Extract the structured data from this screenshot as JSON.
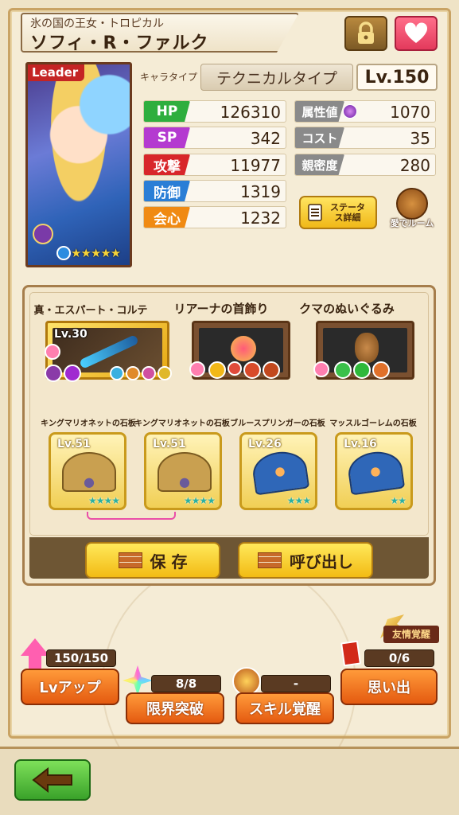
{
  "header": {
    "subtitle": "氷の国の王女・トロピカル",
    "name": "ソフィ・R・ファルク"
  },
  "portrait": {
    "leader_label": "Leader",
    "rarity_stars": "★★★★★"
  },
  "character": {
    "type_label": "キャラタイプ",
    "type_value": "テクニカルタイプ",
    "level": "Lv.150"
  },
  "stats_left": [
    {
      "label": "HP",
      "value": "126310",
      "color": "#2eae3e"
    },
    {
      "label": "SP",
      "value": "342",
      "color": "#b43ad0"
    },
    {
      "label": "攻撃",
      "value": "11977",
      "color": "#d8262a"
    },
    {
      "label": "防御",
      "value": "1319",
      "color": "#2a7ed6"
    },
    {
      "label": "会心",
      "value": "1232",
      "color": "#f08a12"
    }
  ],
  "stats_right": [
    {
      "label": "属性値",
      "value": "1070"
    },
    {
      "label": "コスト",
      "value": "35"
    },
    {
      "label": "親密度",
      "value": "280"
    }
  ],
  "buttons": {
    "status_detail": "ステータス詳細",
    "room": "愛でルーム",
    "save": "保 存",
    "recall": "呼び出し",
    "lv_up": "Lvアップ",
    "limit_break": "限界突破",
    "skill_awaken": "スキル覚醒",
    "memories": "思い出"
  },
  "equipment": {
    "weapon": {
      "name": "真・エスパート・コルテッロ",
      "level": "Lv.30"
    },
    "accessory1": {
      "name": "リアーナの首飾り"
    },
    "accessory2": {
      "name": "クマのぬいぐるみ"
    }
  },
  "tablets": [
    {
      "name": "キングマリオネットの石板",
      "level": "Lv.51",
      "stars": "★★★★",
      "style": "gold"
    },
    {
      "name": "キングマリオネットの石板",
      "level": "Lv.51",
      "stars": "★★★★",
      "style": "gold"
    },
    {
      "name": "ブルースプリンガーの石板",
      "level": "Lv.26",
      "stars": "★★★",
      "style": "blue"
    },
    {
      "name": "マッスルゴーレムの石板",
      "level": "Lv.16",
      "stars": "★★",
      "style": "blue"
    }
  ],
  "progress": {
    "lv_count": "150/150",
    "limit_count": "8/8",
    "skill_count": "-",
    "friend_tag": "友情覚醒",
    "memory_count": "0/6"
  },
  "colors": {
    "accent_yellow": "#f2bb14",
    "accent_orange": "#e45a10",
    "heart_pink": "#e33a5c",
    "back_green": "#3aa22a"
  }
}
